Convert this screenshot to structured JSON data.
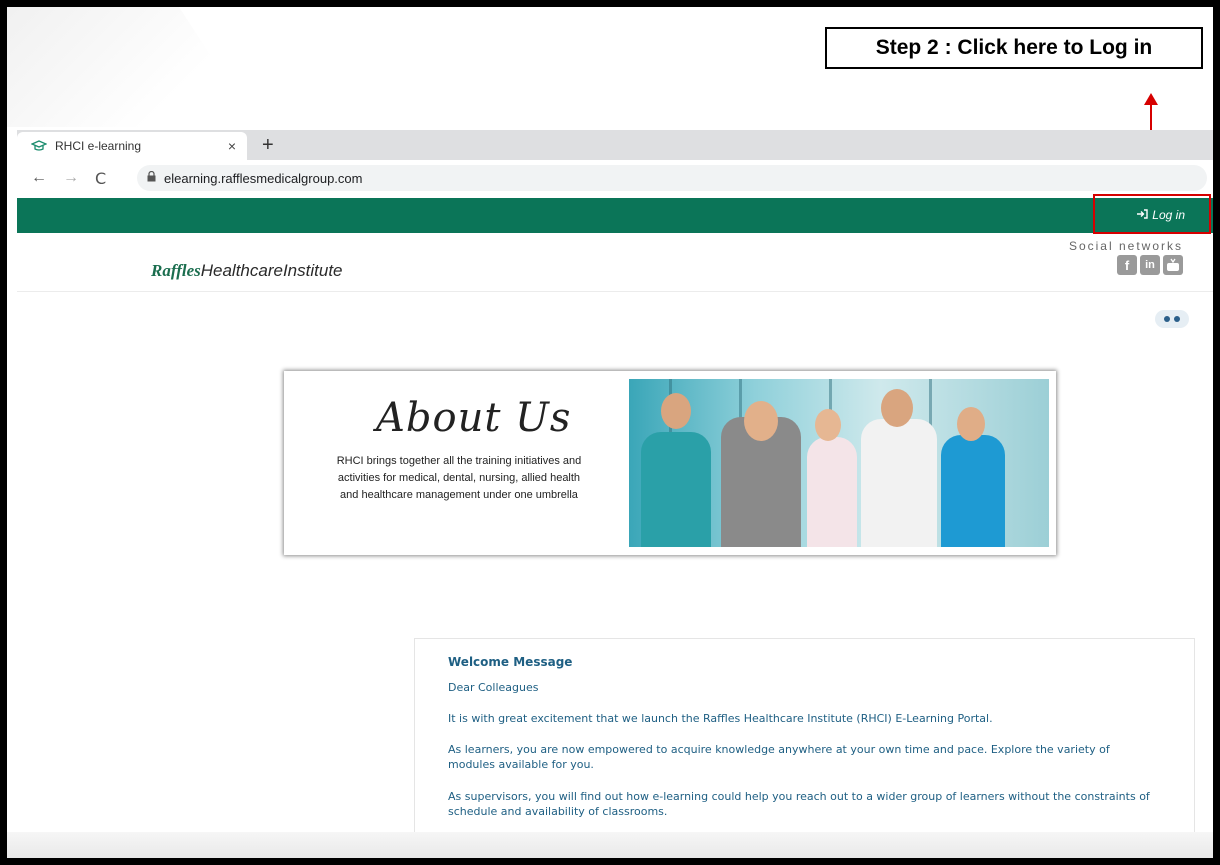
{
  "annotation": {
    "text": "Step 2 : Click here to Log in"
  },
  "browser": {
    "tab_title": "RHCI e-learning",
    "tab_close": "×",
    "new_tab": "+",
    "url": "elearning.rafflesmedicalgroup.com",
    "back": "←",
    "forward": "→",
    "reload": "C"
  },
  "site": {
    "login_label": "Log in",
    "logo_part1": "Raffles",
    "logo_part2": "HealthcareInstitute",
    "social_label": "Social networks",
    "social_icons": [
      "facebook-icon",
      "linkedin-icon",
      "youtube-icon"
    ]
  },
  "banner": {
    "title": "About Us",
    "text": "RHCI brings together all the training initiatives and activities for medical, dental, nursing, allied health and healthcare management under one umbrella"
  },
  "welcome": {
    "title": "Welcome Message",
    "greeting": "Dear Colleagues",
    "p1": "It is with great excitement that we launch the Raffles Healthcare Institute (RHCI) E-Learning Portal.",
    "p2": "As learners, you are now empowered to acquire knowledge anywhere at your own time and pace. Explore the variety of modules available for you.",
    "p3": "As supervisors, you will find out how e-learning could help you reach out to a wider group of learners without the constraints of schedule and availability of classrooms."
  },
  "colors": {
    "green_bar": "#0b7558",
    "annotation_red": "#d60000",
    "welcome_text": "#1e5f83"
  }
}
